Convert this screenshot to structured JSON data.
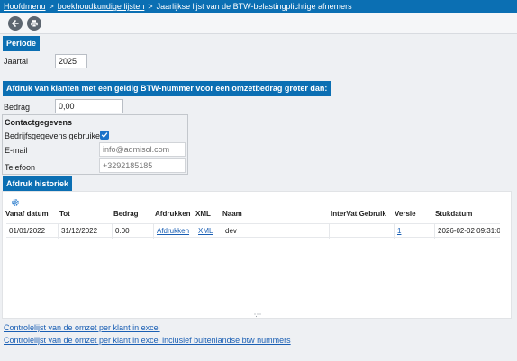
{
  "breadcrumb": {
    "home": "Hoofdmenu",
    "parent": "boekhoudkundige lijsten",
    "current": "Jaarlijkse lijst van de BTW-belastingplichtige afnemers",
    "separator": ">"
  },
  "toolbar": {
    "back_icon": "arrow-left-icon",
    "print_icon": "printer-icon"
  },
  "periode": {
    "heading": "Periode",
    "year_label": "Jaartal",
    "year_value": "2025"
  },
  "threshold": {
    "heading": "Afdruk van klanten met een geldig BTW-nummer voor een omzetbedrag groter dan:",
    "amount_label": "Bedrag",
    "amount_value": "0,00"
  },
  "contact": {
    "heading": "Contactgegevens",
    "use_company_label": "Bedrijfsgegevens gebruiken",
    "use_company_checked": true,
    "email_label": "E-mail",
    "email_placeholder": "info@admisol.com",
    "phone_label": "Telefoon",
    "phone_placeholder": "+3292185185"
  },
  "history": {
    "heading": "Afdruk historiek",
    "settings_icon": "gear-icon",
    "columns": [
      "Vanaf datum",
      "Tot",
      "Bedrag",
      "Afdrukken",
      "XML",
      "Naam",
      "InterVat Gebruik",
      "Versie",
      "Stukdatum"
    ],
    "rows": [
      {
        "from": "01/01/2022",
        "to": "31/12/2022",
        "amount": "0.00",
        "print": "Afdrukken",
        "xml": "XML",
        "name": "dev",
        "intervat": "",
        "version": "1",
        "doc_date": "2026-02-02 09:31:0"
      }
    ]
  },
  "links": {
    "excel": "Controlelijst van de omzet per klant in excel",
    "excel_foreign": "Controlelijst van de omzet per klant in excel inclusief buitenlandse btw nummers"
  },
  "colors": {
    "accent": "#0b6fb3",
    "link": "#1a5fb4",
    "background": "#eef0f3"
  }
}
